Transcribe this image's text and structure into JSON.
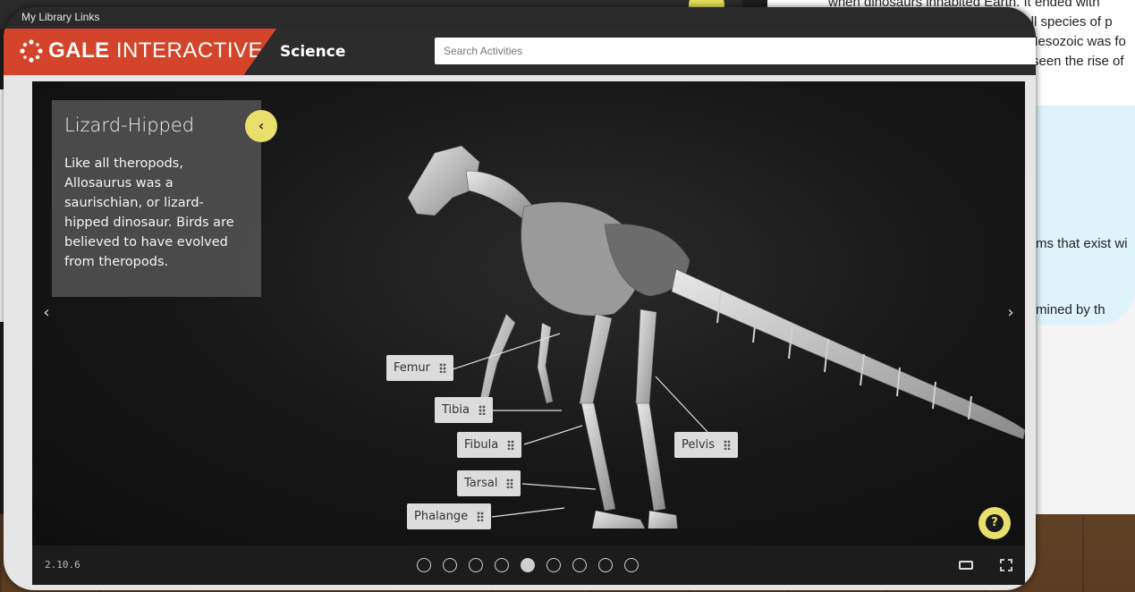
{
  "library_bar": {
    "label": "My Library Links"
  },
  "header": {
    "brand_bold": "GALE",
    "brand_light": "INTERACTIVE",
    "section": "Science",
    "search_placeholder": "Search Activities"
  },
  "info_panel": {
    "title": "Lizard-Hipped",
    "body": "Like all theropods, Allosaurus was a saurischian, or lizard-hipped dinosaur. Birds are believed to have evolved from theropods.",
    "collapse_icon": "chevron-left-icon"
  },
  "bone_labels": [
    "Femur",
    "Tibia",
    "Fibula",
    "Tarsal",
    "Phalange",
    "Pelvis"
  ],
  "footer": {
    "version": "2.10.6",
    "slide_count": 9,
    "active_slide": 5
  },
  "background_page": {
    "lines": [
      "when dinosaurs inhabited Earth. It ended with",
      "f all species of p",
      "Mesozoic was fo",
      "seen the rise of",
      "ms that exist wi",
      "mined by th"
    ]
  },
  "colors": {
    "brand": "#d4442a",
    "accent_yellow": "#e8e06a",
    "header_bg": "#2c2c2c"
  }
}
